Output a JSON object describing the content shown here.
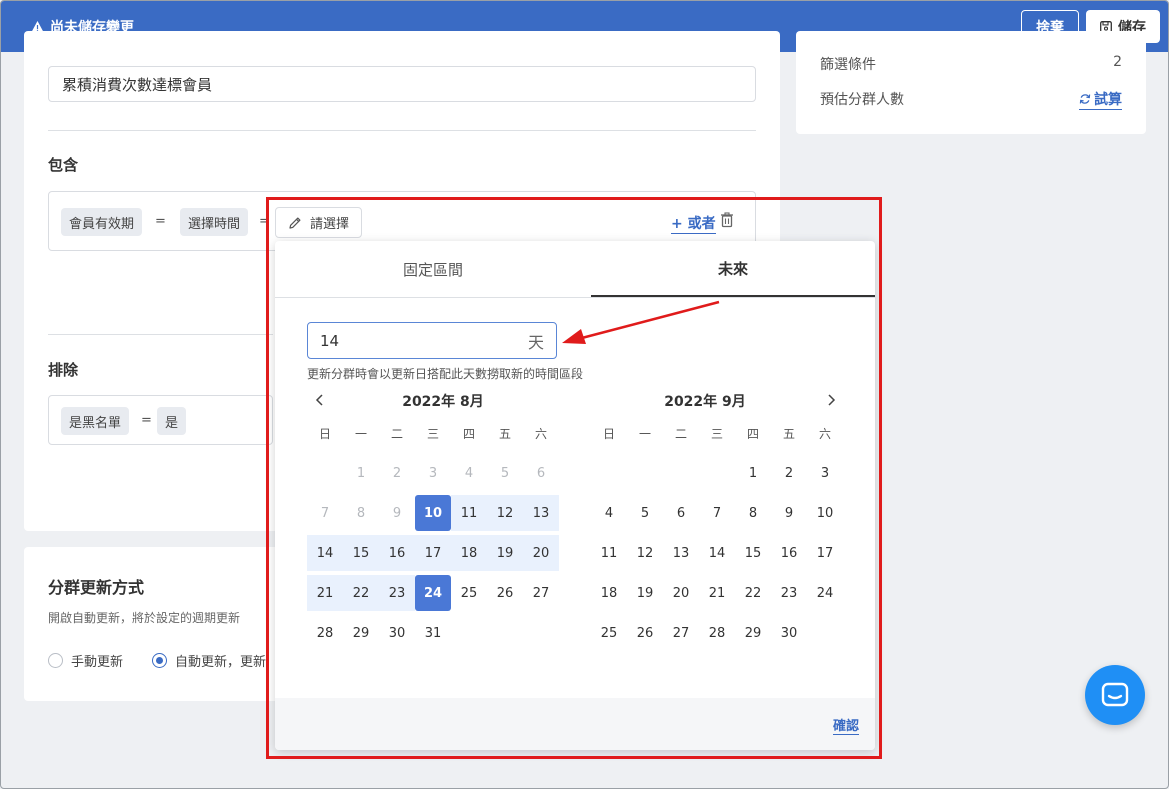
{
  "topbar": {
    "warning_text": "尚未儲存變更",
    "discard_label": "捨棄",
    "save_label": "儲存"
  },
  "form": {
    "name_value": "累積消費次數達標會員",
    "include_title": "包含",
    "include_condition": {
      "tag1": "會員有效期",
      "eq1": "=",
      "tag2": "選擇時間",
      "eq2": "=",
      "choose_label": "請選擇",
      "or_label": "+ 或者"
    },
    "exclude_title": "排除",
    "exclude_condition": {
      "tag1": "是黑名單",
      "eq1": "=",
      "tag2": "是"
    }
  },
  "summary": {
    "filter_label": "篩選條件",
    "filter_count": "2",
    "estimate_label": "預估分群人數",
    "try_label": "試算"
  },
  "update": {
    "title": "分群更新方式",
    "description": "開啟自動更新，將於設定的週期更新",
    "manual_label": "手動更新",
    "auto_label": "自動更新，更新",
    "selected": "auto"
  },
  "date_picker": {
    "tabs": [
      "固定區間",
      "未來"
    ],
    "active_tab": "未來",
    "days_value": "14",
    "days_unit": "天",
    "hint": "更新分群時會以更新日搭配此天數撈取新的時間區段",
    "weekdays": [
      "日",
      "一",
      "二",
      "三",
      "四",
      "五",
      "六"
    ],
    "confirm_label": "確認",
    "months": [
      {
        "title": "2022年 8月",
        "weeks": [
          [
            "",
            "1",
            "2",
            "3",
            "4",
            "5",
            "6"
          ],
          [
            "7",
            "8",
            "9",
            "10",
            "11",
            "12",
            "13"
          ],
          [
            "14",
            "15",
            "16",
            "17",
            "18",
            "19",
            "20"
          ],
          [
            "21",
            "22",
            "23",
            "24",
            "25",
            "26",
            "27"
          ],
          [
            "28",
            "29",
            "30",
            "31",
            "",
            "",
            ""
          ]
        ],
        "muted_days": [
          "1",
          "2",
          "3",
          "4",
          "5",
          "6",
          "7",
          "8",
          "9"
        ],
        "range_start": "10",
        "range_end": "24"
      },
      {
        "title": "2022年 9月",
        "weeks": [
          [
            "",
            "",
            "",
            "",
            "1",
            "2",
            "3"
          ],
          [
            "4",
            "5",
            "6",
            "7",
            "8",
            "9",
            "10"
          ],
          [
            "11",
            "12",
            "13",
            "14",
            "15",
            "16",
            "17"
          ],
          [
            "18",
            "19",
            "20",
            "21",
            "22",
            "23",
            "24"
          ],
          [
            "25",
            "26",
            "27",
            "28",
            "29",
            "30",
            ""
          ]
        ]
      }
    ]
  },
  "colors": {
    "brand": "#3a6bc4",
    "selected_day": "#4a78d6",
    "range_day": "#e9f1fd",
    "annotation": "#e01b1b",
    "chat": "#1f8ff5"
  }
}
